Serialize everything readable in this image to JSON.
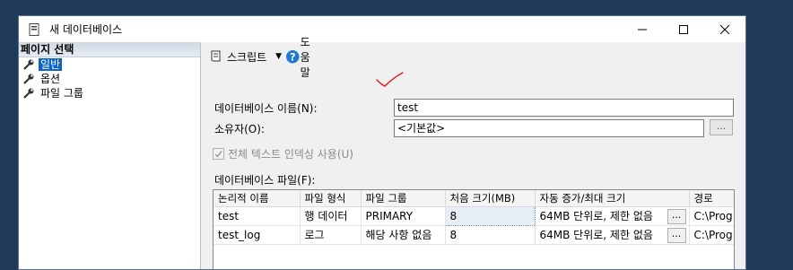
{
  "window": {
    "title": "새 데이터베이스"
  },
  "left_pane": {
    "header": "페이지 선택",
    "items": [
      {
        "label": "일반",
        "selected": true
      },
      {
        "label": "옵션",
        "selected": false
      },
      {
        "label": "파일 그룹",
        "selected": false
      }
    ]
  },
  "toolbar": {
    "script_label": "스크립트",
    "dropdown_icon": "chevron-down-icon",
    "help_label": "도움말"
  },
  "form": {
    "db_name_label": "데이터베이스 이름(N):",
    "db_name_value": "test",
    "owner_label": "소유자(O):",
    "owner_value": "<기본값>",
    "owner_browse": "...",
    "fulltext_label": "전체 텍스트 인덱싱 사용(U)",
    "fulltext_checked": true,
    "files_label": "데이터베이스 파일(F):"
  },
  "files_table": {
    "headers": [
      "논리적 이름",
      "파일 형식",
      "파일 그룹",
      "처음 크기(MB)",
      "자동 증가/최대 크기",
      "경로"
    ],
    "rows": [
      {
        "logical_name": "test",
        "file_type": "행 데이터",
        "filegroup": "PRIMARY",
        "initial_size": "8",
        "autogrowth": "64MB 단위로, 제한 없음",
        "autogrowth_btn": "...",
        "path": "C:\\Prog"
      },
      {
        "logical_name": "test_log",
        "file_type": "로그",
        "filegroup": "해당 사항 없음",
        "initial_size": "8",
        "autogrowth": "64MB 단위로, 제한 없음",
        "autogrowth_btn": "...",
        "path": "C:\\Prog"
      }
    ]
  },
  "colors": {
    "selection": "#0a64c8",
    "annotation": "#e02020",
    "help_icon": "#1e78d2"
  }
}
